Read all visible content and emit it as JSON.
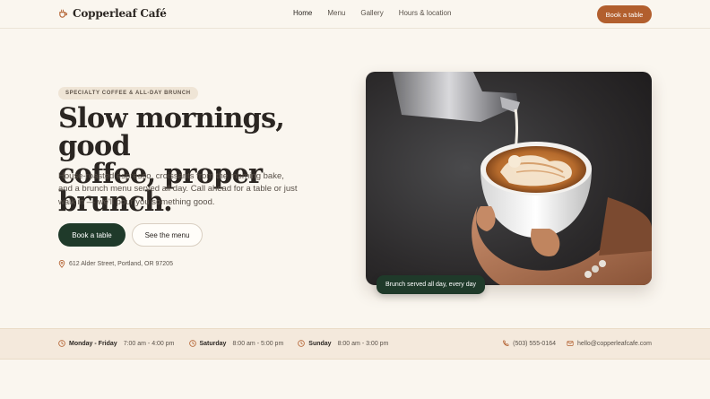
{
  "brand": {
    "name": "Copperleaf Café"
  },
  "nav": {
    "items": [
      "Home",
      "Menu",
      "Gallery",
      "Hours & location"
    ],
    "active": "Home",
    "cta": "Book a table"
  },
  "hero": {
    "eyebrow": "SPECIALTY COFFEE & ALL-DAY BRUNCH",
    "title_line1": "Slow mornings, good",
    "title_line2": "coffee, proper brunch.",
    "body": "House-roasted espresso, croissants from the morning bake, and a brunch menu served all day. Call ahead for a table or just walk in — we'll pour you something good.",
    "primary_cta": "Book a table",
    "secondary_cta": "See the menu",
    "address": "612 Alder Street, Portland, OR 97205",
    "photo_badge": "Brunch served all day, every day"
  },
  "info": {
    "hours": [
      {
        "days": "Monday - Friday",
        "time": "7:00 am - 4:00 pm"
      },
      {
        "days": "Saturday",
        "time": "8:00 am - 5:00 pm"
      },
      {
        "days": "Sunday",
        "time": "8:00 am - 3:00 pm"
      }
    ],
    "phone": "(503) 555-0164",
    "email": "hello@copperleafcafe.com"
  },
  "colors": {
    "accent": "#b25f2e",
    "dark_green": "#1f3a2a",
    "background": "#faf6ef",
    "info_bar": "#f4e9dc"
  },
  "icons": [
    "coffee-cup-icon",
    "map-pin-icon",
    "clock-icon",
    "phone-icon",
    "mail-icon"
  ]
}
